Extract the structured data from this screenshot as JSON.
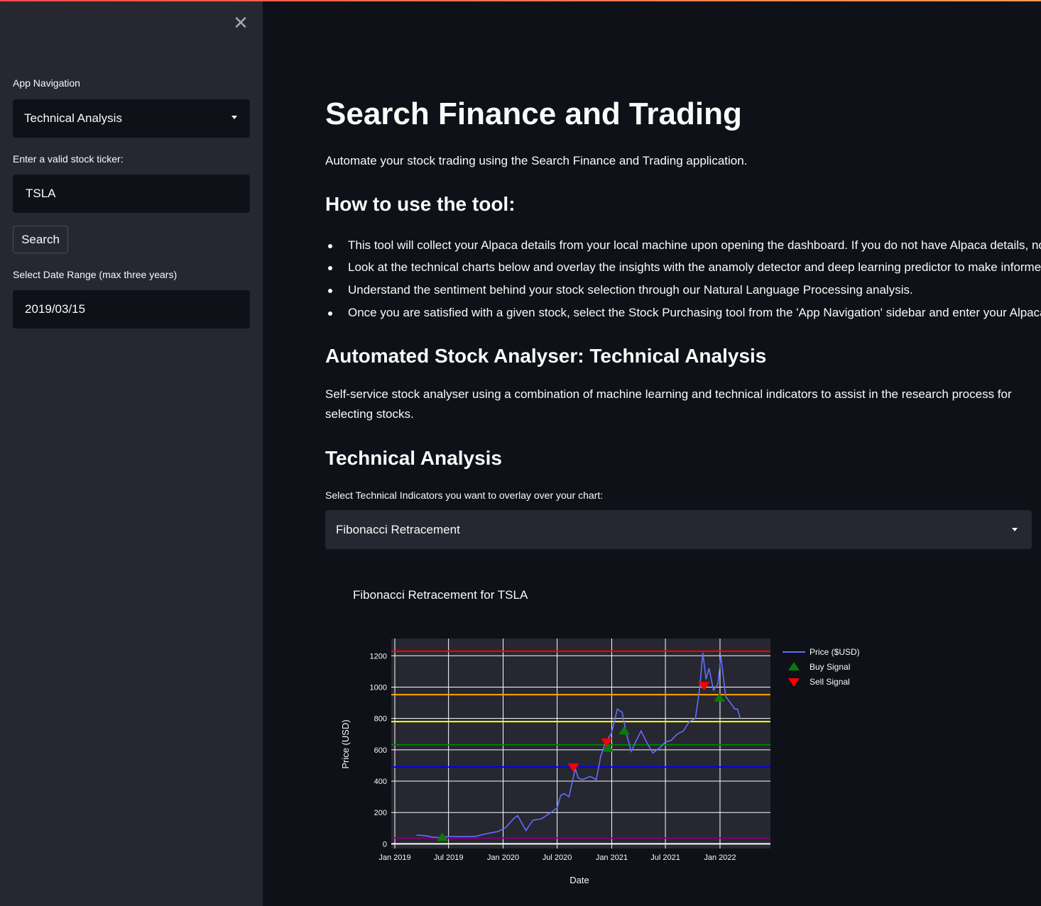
{
  "sidebar": {
    "nav_label": "App Navigation",
    "nav_value": "Technical Analysis",
    "ticker_label": "Enter a valid stock ticker:",
    "ticker_value": "TSLA",
    "search_label": "Search",
    "date_label": "Select Date Range (max three years)",
    "date_value": "2019/03/15",
    "close_icon": "close-icon"
  },
  "main": {
    "title": "Search Finance and Trading",
    "intro": "Automate your stock trading using the Search Finance and Trading application.",
    "howto_heading": "How to use the tool:",
    "bullets": [
      "This tool will collect your Alpaca details from your local machine upon opening the dashboard. If you do not have Alpaca details, no pr",
      "Look at the technical charts below and overlay the insights with the anamoly detector and deep learning predictor to make informed c",
      "Understand the sentiment behind your stock selection through our Natural Language Processing analysis.",
      "Once you are satisfied with a given stock, select the Stock Purchasing tool from the 'App Navigation' sidebar and enter your Alpaca det"
    ],
    "analyser_heading": "Automated Stock Analyser: Technical Analysis",
    "analyser_desc_1": "Self-service stock analyser using a combination of machine learning and technical indicators to assist in the research process for",
    "analyser_desc_2": "selecting stocks.",
    "ta_heading": "Technical Analysis",
    "indicator_label": "Select Technical Indicators you want to overlay over your chart:",
    "indicator_value": "Fibonacci Retracement"
  },
  "chart_data": {
    "type": "line",
    "title": "Fibonacci Retracement for TSLA",
    "xlabel": "Date",
    "ylabel": "Price (USD)",
    "xlim": [
      "2018-12-20",
      "2022-06-20"
    ],
    "ylim": [
      -30,
      1310
    ],
    "x_ticks": [
      "Jan 2019",
      "Jul 2019",
      "Jan 2020",
      "Jul 2020",
      "Jan 2021",
      "Jul 2021",
      "Jan 2022"
    ],
    "y_ticks": [
      0,
      200,
      400,
      600,
      800,
      1000,
      1200
    ],
    "legend": [
      "Price ($USD)",
      "Buy Signal",
      "Sell Signal"
    ],
    "legend_position": "right",
    "grid": true,
    "colors": {
      "price": "#636efa",
      "buy": "#0a7a0a",
      "sell": "#ff0000",
      "plot_bg": "#262730",
      "fib_levels": [
        "#ff0000",
        "#ffa500",
        "#ffff00",
        "#008000",
        "#0000ff",
        "#800080",
        "#ffffff"
      ]
    },
    "fib_levels": [
      1229,
      952,
      780,
      632,
      490,
      36,
      0
    ],
    "series": [
      {
        "name": "Price ($USD)",
        "x": [
          "2019-03-15",
          "2019-04-01",
          "2019-04-20",
          "2019-05-10",
          "2019-06-01",
          "2019-06-20",
          "2019-07-10",
          "2019-08-01",
          "2019-09-01",
          "2019-10-01",
          "2019-10-25",
          "2019-11-20",
          "2019-12-15",
          "2020-01-10",
          "2020-02-05",
          "2020-02-19",
          "2020-03-18",
          "2020-04-10",
          "2020-05-10",
          "2020-06-10",
          "2020-07-01",
          "2020-07-13",
          "2020-07-25",
          "2020-08-10",
          "2020-08-31",
          "2020-09-10",
          "2020-09-25",
          "2020-10-20",
          "2020-11-10",
          "2020-11-25",
          "2020-12-10",
          "2020-12-31",
          "2021-01-20",
          "2021-02-05",
          "2021-02-20",
          "2021-03-08",
          "2021-03-25",
          "2021-04-10",
          "2021-05-01",
          "2021-05-20",
          "2021-06-10",
          "2021-07-01",
          "2021-07-20",
          "2021-08-10",
          "2021-08-30",
          "2021-09-20",
          "2021-10-10",
          "2021-10-25",
          "2021-11-04",
          "2021-11-15",
          "2021-11-25",
          "2021-12-10",
          "2021-12-25",
          "2022-01-04",
          "2022-01-20",
          "2022-02-05",
          "2022-02-20",
          "2022-03-01",
          "2022-03-10"
        ],
        "values": [
          55,
          54,
          50,
          42,
          40,
          45,
          47,
          46,
          46,
          48,
          60,
          70,
          78,
          105,
          160,
          180,
          85,
          150,
          160,
          200,
          230,
          310,
          320,
          300,
          480,
          420,
          410,
          430,
          410,
          560,
          640,
          705,
          860,
          840,
          700,
          590,
          660,
          720,
          640,
          580,
          610,
          650,
          660,
          700,
          720,
          780,
          800,
          1000,
          1220,
          1050,
          1120,
          980,
          1020,
          1200,
          940,
          900,
          860,
          860,
          800
        ]
      }
    ],
    "buy_signals": {
      "x": [
        "2019-06-10",
        "2020-12-20",
        "2021-02-12",
        "2021-12-30"
      ],
      "y": [
        40,
        610,
        720,
        930
      ]
    },
    "sell_signals": {
      "x": [
        "2020-08-25",
        "2020-12-15",
        "2021-11-08"
      ],
      "y": [
        490,
        650,
        1010
      ]
    }
  }
}
